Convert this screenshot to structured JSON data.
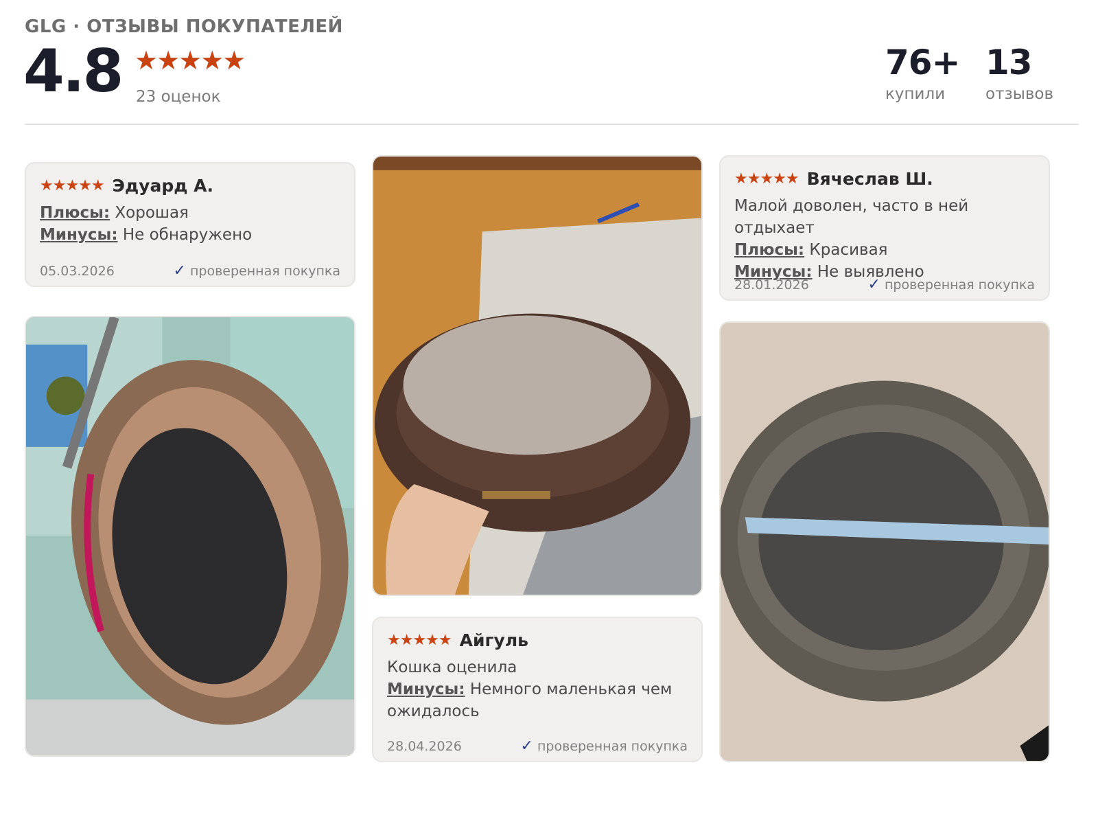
{
  "header": {
    "brand": "GLG · ОТЗЫВЫ ПОКУПАТЕЛЕЙ",
    "rating": "4.8",
    "stars": "★★★★★",
    "ratings_count": "23 оценок",
    "bought_value": "76+",
    "bought_label": "купили",
    "reviews_value": "13",
    "reviews_label": "отзывов"
  },
  "colors": {
    "star": "#c94412",
    "check": "#2b3f86",
    "card_bg": "#f1f0ee"
  },
  "reviews": [
    {
      "stars": "★★★★★",
      "author": "Эдуард А.",
      "pros_label": "Плюсы:",
      "pros": "Хорошая",
      "cons_label": "Минусы:",
      "cons": "Не обнаружено",
      "date": "05.03.2026",
      "verified": "проверенная покупка"
    },
    {
      "stars": "★★★★★",
      "author": "Вячеслав Ш.",
      "comment": "Малой доволен, часто в ней отдыхает",
      "pros_label": "Плюсы:",
      "pros": "Красивая",
      "cons_label": "Минусы:",
      "cons": "Не выявлено",
      "date": "28.01.2026",
      "verified": "проверенная покупка"
    },
    {
      "stars": "★★★★★",
      "author": "Айгуль",
      "comment": "Кошка оценила",
      "cons_label": "Минусы:",
      "cons": "Немного маленькая чем ожидалось",
      "date": "28.04.2026",
      "verified": "проверенная покупка"
    }
  ],
  "photos": [
    {
      "subject": "brown oval pet bed with black cushion"
    },
    {
      "subject": "dark brown pet bed with beige cushion held by hand"
    },
    {
      "subject": "grey pet bed with measuring tape"
    }
  ]
}
